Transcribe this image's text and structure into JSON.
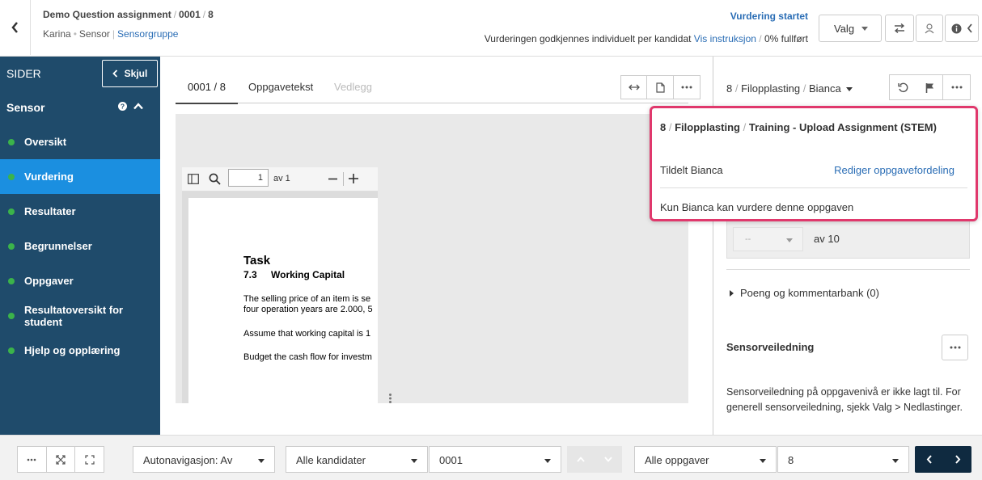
{
  "header": {
    "assignment": "Demo Question assignment",
    "candidate": "0001",
    "question": "8",
    "user": "Karina",
    "role": "Sensor",
    "group_link": "Sensorgruppe",
    "status_title": "Vurdering startet",
    "status_text": "Vurderingen godkjennes individuelt per kandidat",
    "instructions_link": "Vis instruksjon",
    "progress": "0% fullført",
    "valg_label": "Valg"
  },
  "sidebar": {
    "title": "SIDER",
    "hide_label": "Skjul",
    "section": "Sensor",
    "items": [
      {
        "label": "Oversikt"
      },
      {
        "label": "Vurdering"
      },
      {
        "label": "Resultater"
      },
      {
        "label": "Begrunnelser"
      },
      {
        "label": "Oppgaver"
      },
      {
        "label": "Resultatoversikt for student"
      },
      {
        "label": "Hjelp og opplæring"
      }
    ]
  },
  "tabs": {
    "t1": "0001 / 8",
    "t2": "Oppgavetekst",
    "t3": "Vedlegg"
  },
  "pdf": {
    "page": "1",
    "of": "av 1",
    "task_title": "Task",
    "task_num": "7.3",
    "task_name": "Working Capital",
    "line1": "The selling price of an item is se",
    "line2": "four operation years are 2.000, 5",
    "line3": "Assume that working capital is 1",
    "line4": "Budget the cash flow for investm"
  },
  "right": {
    "q_num": "8",
    "q_type": "Filopplasting",
    "assignee": "Bianca",
    "score_placeholder": "--",
    "score_of": "av 10",
    "bank_label": "Poeng og kommentarbank (0)",
    "guide_title": "Sensorveiledning",
    "guide_text": "Sensorveiledning på oppgavenivå er ikke lagt til. For generell sensorveiledning, sjekk Valg > Nedlastinger."
  },
  "popup": {
    "q_num": "8",
    "q_type": "Filopplasting",
    "q_title": "Training - Upload Assignment (STEM)",
    "assigned": "Tildelt Bianca",
    "edit_link": "Rediger oppgavefordeling",
    "note": "Kun Bianca kan vurdere denne oppgaven"
  },
  "bottom": {
    "autonav": "Autonavigasjon: Av",
    "candidates": "Alle kandidater",
    "candidate": "0001",
    "tasks": "Alle oppgaver",
    "task": "8"
  },
  "colors": {
    "sidebar": "#1f4b6b",
    "active": "#1b8fe0",
    "link": "#2a6db5",
    "highlight": "#e0386c",
    "bullet": "#3bb34a",
    "navy": "#0f2a40"
  }
}
